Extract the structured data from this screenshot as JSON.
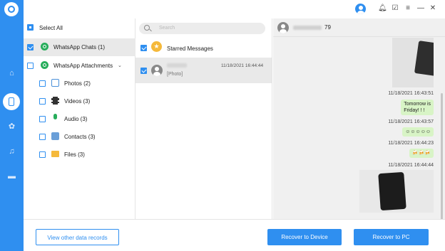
{
  "sidebar_nav": {
    "items": [
      {
        "icon": "home-icon"
      },
      {
        "icon": "phone-icon",
        "active": true
      },
      {
        "icon": "settings-icon"
      },
      {
        "icon": "music-icon"
      },
      {
        "icon": "folder-icon"
      }
    ]
  },
  "categories": {
    "select_all": "Select All",
    "items": [
      {
        "label": "WhatsApp Chats (1)",
        "checked": true,
        "selected": true,
        "icon": "whatsapp-icon"
      },
      {
        "label": "WhatsApp Attachments",
        "checked": false,
        "icon": "whatsapp-icon",
        "expanded": true
      },
      {
        "label": "Photos (2)",
        "checked": false,
        "icon": "photos-icon"
      },
      {
        "label": "Videos (3)",
        "checked": false,
        "icon": "videos-icon"
      },
      {
        "label": "Audio (3)",
        "checked": false,
        "icon": "microphone-icon"
      },
      {
        "label": "Contacts (3)",
        "checked": false,
        "icon": "contact-icon"
      },
      {
        "label": "Files (3)",
        "checked": false,
        "icon": "folder-icon"
      }
    ]
  },
  "conversations": {
    "search_placeholder": "Search",
    "starred_label": "Starred Messages",
    "items": [
      {
        "name": "blurred contact",
        "timestamp": "11/18/2021 16:44:44",
        "preview": "[Photo]",
        "checked": true
      }
    ]
  },
  "chat": {
    "header_suffix": "79",
    "messages": [
      {
        "type": "image"
      },
      {
        "timestamp": "11/18/2021 16:43:51",
        "text": [
          "Tomorrow is",
          "Friday! ! !"
        ]
      },
      {
        "timestamp": "11/18/2021 16:43:57",
        "text": [
          "☺☺☺☺☺"
        ]
      },
      {
        "timestamp": "11/18/2021 16:44:23",
        "text": [
          "🍻🍻🍻"
        ]
      },
      {
        "timestamp": "11/18/2021 16:44:44",
        "type": "image"
      }
    ]
  },
  "footer": {
    "view_other": "View other data records",
    "recover_device": "Recover to Device",
    "recover_pc": "Recover to PC"
  },
  "colors": {
    "accent": "#2f8ff0",
    "bubble": "#d8f4c6",
    "whatsapp": "#27ad5b"
  }
}
